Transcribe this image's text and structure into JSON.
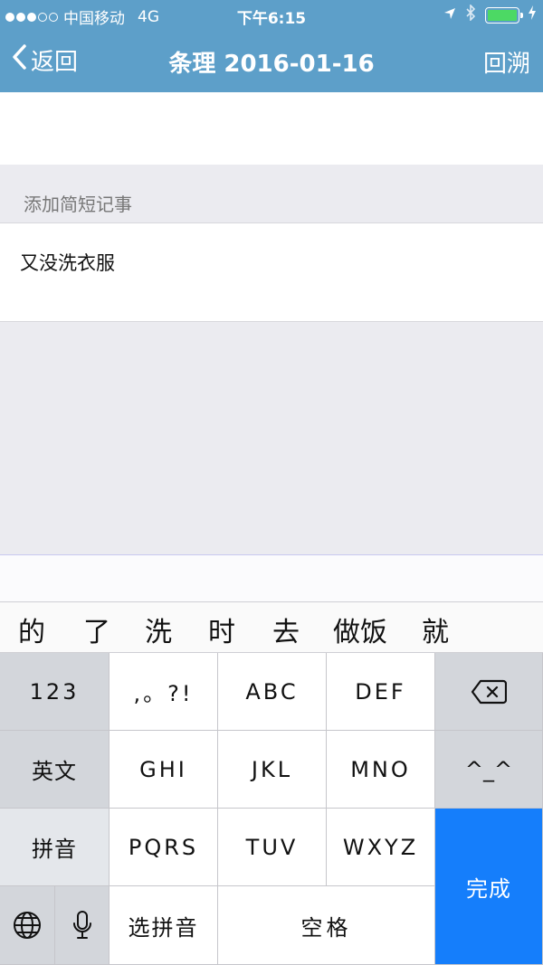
{
  "status_bar": {
    "carrier": "中国移动",
    "network": "4G",
    "time": "下午6:15"
  },
  "nav": {
    "back_label": "返回",
    "title": "条理 2016-01-16",
    "right_label": "回溯"
  },
  "note_section": {
    "header": "添加简短记事",
    "note": "又没洗衣服"
  },
  "candidates": [
    "的",
    "了",
    "洗",
    "时",
    "去",
    "做饭",
    "就"
  ],
  "keyboard": {
    "numbers": "123",
    "punct": ",。?!",
    "abc": "ABC",
    "def": "DEF",
    "english": "英文",
    "ghi": "GHI",
    "jkl": "JKL",
    "mno": "MNO",
    "emoticon": "^_^",
    "pinyin": "拼音",
    "pqrs": "PQRS",
    "tuv": "TUV",
    "wxyz": "WXYZ",
    "select_pinyin": "选拼音",
    "space": "空格",
    "done": "完成"
  },
  "colors": {
    "nav_bg": "#5d9fc9",
    "done_key": "#157efb",
    "battery": "#4cd964"
  }
}
